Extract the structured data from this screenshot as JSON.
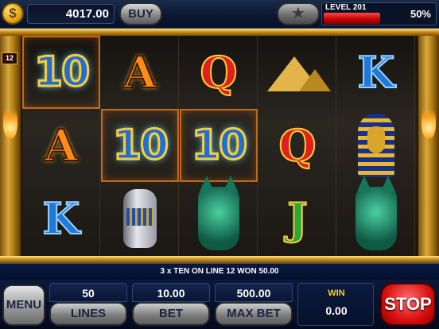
{
  "topbar": {
    "coin_symbol": "$",
    "balance": "4017.00",
    "buy_label": "BUY",
    "star_icon": "★",
    "level_label": "LEVEL 201",
    "level_percent_text": "50%",
    "level_progress": 0.5
  },
  "reels": {
    "line_indicator": "12",
    "columns": [
      [
        "10",
        "A",
        "K"
      ],
      [
        "A",
        "10",
        "vase"
      ],
      [
        "Q",
        "10",
        "cat"
      ],
      [
        "pyramid",
        "Q",
        "J"
      ],
      [
        "K",
        "pharaoh",
        "cat"
      ]
    ],
    "winning_cells": [
      [
        0,
        0
      ],
      [
        1,
        1
      ],
      [
        2,
        1
      ]
    ]
  },
  "status": {
    "message": "3 x TEN ON LINE 12 WON 50.00"
  },
  "controls": {
    "menu_label": "MENU",
    "lines_value": "50",
    "lines_label": "LINES",
    "bet_value": "10.00",
    "bet_label": "BET",
    "maxbet_value": "500.00",
    "maxbet_label": "MAX BET",
    "win_label": "WIN",
    "win_value": "0.00",
    "stop_label": "STOP"
  },
  "colors": {
    "accent_gold": "#d9a93a",
    "stop_red": "#d81010",
    "win_yellow": "#ffd21f"
  }
}
